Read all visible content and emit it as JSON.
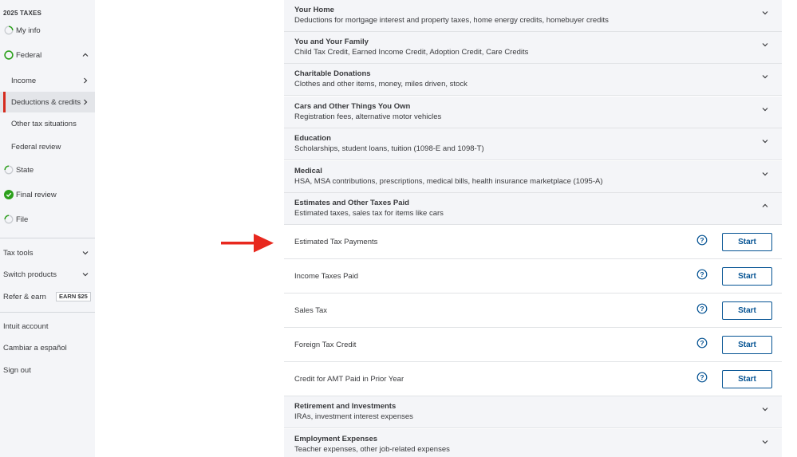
{
  "sidebar": {
    "year_label": "2025 TAXES",
    "nav": [
      {
        "label": "My info",
        "status": "in-progress"
      },
      {
        "label": "Federal",
        "status": "open"
      },
      {
        "label": "Income"
      },
      {
        "label": "Deductions & credits",
        "active": true
      },
      {
        "label": "Other tax situations"
      },
      {
        "label": "Federal review"
      },
      {
        "label": "State",
        "status": "in-progress"
      },
      {
        "label": "Final review",
        "status": "complete"
      },
      {
        "label": "File",
        "status": "in-progress"
      }
    ],
    "tools": [
      {
        "label": "Tax tools"
      },
      {
        "label": "Switch products"
      },
      {
        "label": "Refer & earn",
        "badge": "EARN $25"
      }
    ],
    "account": [
      {
        "label": "Intuit account"
      },
      {
        "label": "Cambiar a español"
      },
      {
        "label": "Sign out"
      }
    ]
  },
  "categories": [
    {
      "title": "Your Home",
      "desc": "Deductions for mortgage interest and property taxes, home energy credits, homebuyer credits"
    },
    {
      "title": "You and Your Family",
      "desc": "Child Tax Credit, Earned Income Credit, Adoption Credit, Care Credits"
    },
    {
      "title": "Charitable Donations",
      "desc": "Clothes and other items, money, miles driven, stock"
    },
    {
      "title": "Cars and Other Things You Own",
      "desc": "Registration fees, alternative motor vehicles"
    },
    {
      "title": "Education",
      "desc": "Scholarships, student loans, tuition (1098-E and 1098-T)"
    },
    {
      "title": "Medical",
      "desc": "HSA, MSA contributions, prescriptions, medical bills, health insurance marketplace (1095-A)"
    },
    {
      "title": "Estimates and Other Taxes Paid",
      "desc": "Estimated taxes, sales tax for items like cars",
      "expanded": true
    },
    {
      "title": "Retirement and Investments",
      "desc": "IRAs, investment interest expenses"
    },
    {
      "title": "Employment Expenses",
      "desc": "Teacher expenses, other job-related expenses"
    }
  ],
  "expanded_items": [
    {
      "label": "Estimated Tax Payments",
      "button": "Start"
    },
    {
      "label": "Income Taxes Paid",
      "button": "Start"
    },
    {
      "label": "Sales Tax",
      "button": "Start"
    },
    {
      "label": "Foreign Tax Credit",
      "button": "Start"
    },
    {
      "label": "Credit for AMT Paid in Prior Year",
      "button": "Start"
    }
  ],
  "colors": {
    "brand_blue": "#055393",
    "complete_green": "#2ca01c",
    "active_red": "#d52b1e",
    "arrow_red": "#e8281e",
    "sidebar_bg": "#f4f5f8"
  },
  "icons": {
    "help": "question-circle-icon",
    "expand": "chevron-down-icon",
    "collapse": "chevron-up-icon",
    "arrow": "arrow-right-icon"
  }
}
